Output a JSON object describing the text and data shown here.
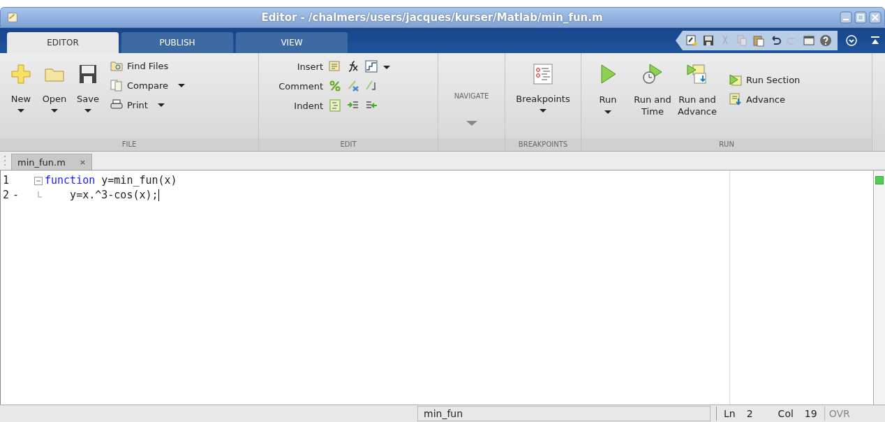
{
  "window": {
    "title": "Editor - /chalmers/users/jacques/kurser/Matlab/min_fun.m"
  },
  "tabs": [
    {
      "label": "EDITOR",
      "selected": true
    },
    {
      "label": "PUBLISH",
      "selected": false
    },
    {
      "label": "VIEW",
      "selected": false
    }
  ],
  "ribbon": {
    "file": {
      "label": "FILE",
      "big_buttons": [
        {
          "label": "New",
          "dropdown": true
        },
        {
          "label": "Open",
          "dropdown": true
        },
        {
          "label": "Save",
          "dropdown": true
        }
      ],
      "small_buttons": [
        {
          "label": "Find Files",
          "dropdown": false
        },
        {
          "label": "Compare",
          "dropdown": true
        },
        {
          "label": "Print",
          "dropdown": true
        }
      ]
    },
    "edit": {
      "label": "EDIT",
      "rows": [
        {
          "label": "Insert",
          "dropdown": true
        },
        {
          "label": "Comment",
          "dropdown": false
        },
        {
          "label": "Indent",
          "dropdown": false
        }
      ]
    },
    "navigate": {
      "label": "NAVIGATE"
    },
    "breakpoints": {
      "label": "BREAKPOINTS",
      "button": {
        "label": "Breakpoints",
        "dropdown": true
      }
    },
    "run": {
      "label": "RUN",
      "big_buttons": [
        {
          "label": "Run",
          "dropdown": true
        },
        {
          "label": "Run and Time",
          "dropdown": false
        },
        {
          "label": "Run and Advance",
          "dropdown": false
        }
      ],
      "small_buttons": [
        {
          "label": "Run Section"
        },
        {
          "label": "Advance"
        }
      ]
    }
  },
  "file_tabs": [
    {
      "label": "min_fun.m",
      "selected": true
    }
  ],
  "lines": [
    {
      "number": "1",
      "kind": "start",
      "cursor": false,
      "parts": [
        {
          "text": "function",
          "kind": "keyword"
        },
        {
          "text": " y=min_fun(x)",
          "kind": "plain"
        }
      ]
    },
    {
      "number": "2",
      "marker": "-",
      "kind": "end",
      "cursor": true,
      "parts": [
        {
          "text": "    y=x.^3-cos(x);",
          "kind": "plain"
        }
      ]
    }
  ],
  "status_bar": {
    "function": "min_fun",
    "ln_label": "Ln",
    "ln": "2",
    "col_label": "Col",
    "col": "19",
    "ovr": {
      "label": "OVR",
      "disabled": true
    }
  }
}
